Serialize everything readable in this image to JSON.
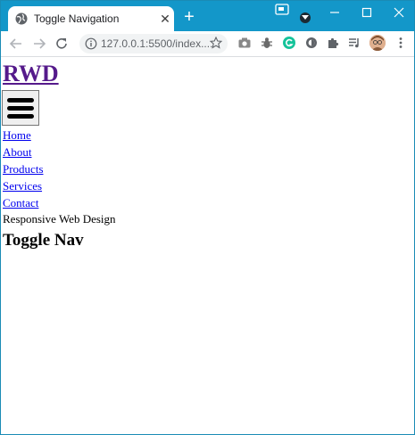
{
  "browser": {
    "tab_title": "Toggle Navigation",
    "url": "127.0.0.1:5500/index....",
    "accent_color": "#1397c9"
  },
  "page": {
    "logo": "RWD",
    "nav": [
      {
        "label": "Home"
      },
      {
        "label": "About"
      },
      {
        "label": "Products"
      },
      {
        "label": "Services"
      },
      {
        "label": "Contact"
      }
    ],
    "tagline": "Responsive Web Design",
    "heading": "Toggle Nav"
  }
}
